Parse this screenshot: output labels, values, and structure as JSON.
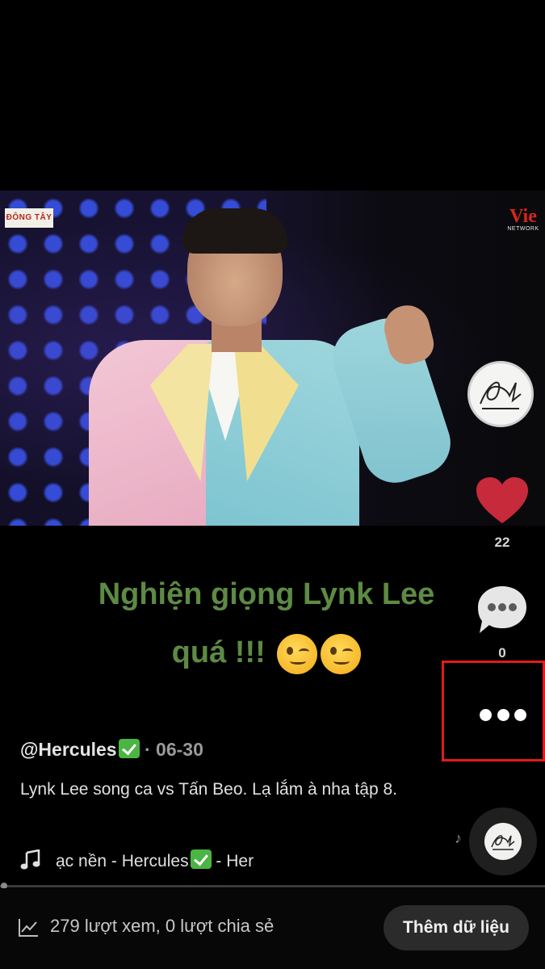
{
  "video": {
    "logo_left": "ĐÔNG TÂY",
    "logo_right_big": "Vie",
    "logo_right_small": "NETWORK"
  },
  "caption_overlay": {
    "line1": "Nghiện giọng Lynk Lee",
    "line2": "quá !!!"
  },
  "actions": {
    "like_count": "22",
    "comment_count": "0",
    "icons": [
      "avatar",
      "heart-icon",
      "comment-icon",
      "more-icon"
    ],
    "heart_color": "#c62a3b",
    "highlight_color": "#e21b1b"
  },
  "post": {
    "author": "@Hercules",
    "separator": " · ",
    "date": "06-30",
    "description": "Lynk Lee song ca vs Tấn Beo. Lạ lắm à nha tập 8.",
    "music": "ạc nền - Hercules",
    "music_suffix": " - Her"
  },
  "bottom": {
    "stats": "279 lượt xem, 0 lượt chia sẻ",
    "add_data_label": "Thêm dữ liệu"
  }
}
